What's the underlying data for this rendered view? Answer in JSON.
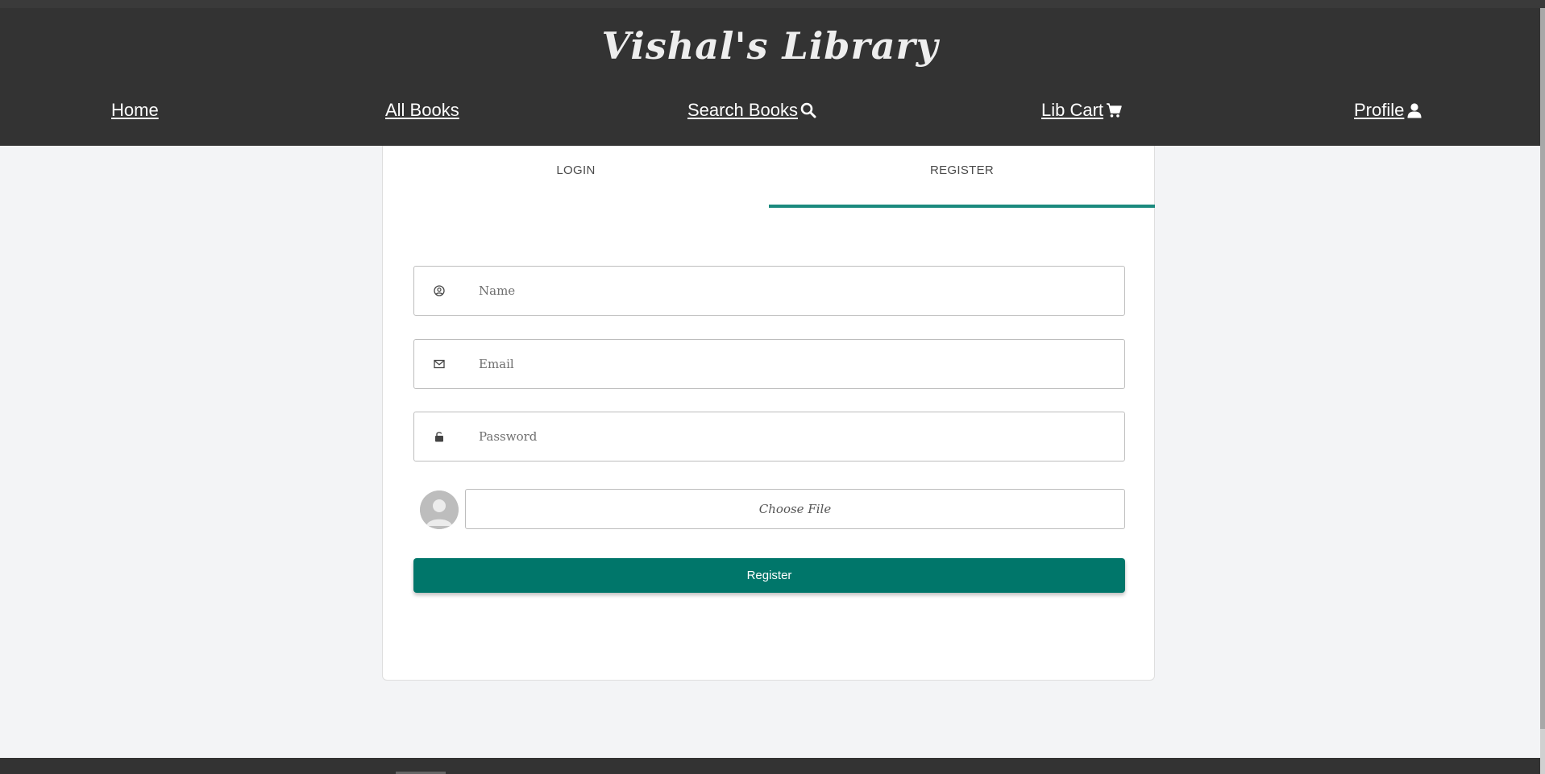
{
  "site": {
    "title": "Vishal's Library"
  },
  "nav": [
    {
      "label": "Home",
      "icon": ""
    },
    {
      "label": "All Books",
      "icon": ""
    },
    {
      "label": "Search Books",
      "icon": "search-icon"
    },
    {
      "label": "Lib Cart ",
      "icon": "cart-icon"
    },
    {
      "label": "Profile ",
      "icon": "user-icon"
    }
  ],
  "tabs": [
    {
      "label": "LOGIN",
      "active": false
    },
    {
      "label": "REGISTER",
      "active": true
    }
  ],
  "form": {
    "name_placeholder": "Name",
    "email_placeholder": "Email",
    "password_placeholder": "Password",
    "file_label": "Choose File",
    "submit_label": "Register"
  },
  "colors": {
    "header_bg": "#333333",
    "accent": "#00766a",
    "tab_indicator": "#1b8a7e",
    "page_bg": "#f3f4f6"
  }
}
